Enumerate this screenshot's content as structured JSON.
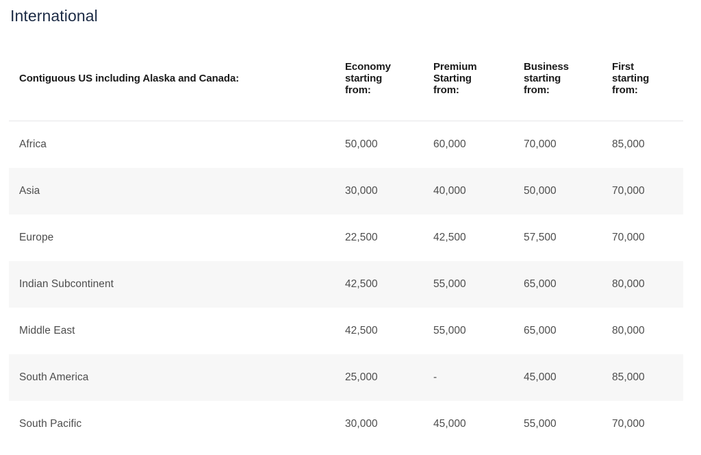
{
  "section": {
    "title": "International",
    "title_color": "#1c2b45"
  },
  "table": {
    "row_header_label": "Contiguous US including Alaska and Canada:",
    "columns": [
      {
        "key": "region",
        "lines": [
          "Contiguous US including Alaska and Canada:"
        ]
      },
      {
        "key": "economy",
        "lines": [
          "Economy",
          "starting",
          "from:"
        ]
      },
      {
        "key": "premium",
        "lines": [
          "Premium",
          "Starting",
          "from:"
        ]
      },
      {
        "key": "business",
        "lines": [
          "Business",
          "starting",
          "from:"
        ]
      },
      {
        "key": "first",
        "lines": [
          "First",
          "starting",
          "from:"
        ]
      }
    ],
    "rows": [
      {
        "region": "Africa",
        "economy": "50,000",
        "premium": "60,000",
        "business": "70,000",
        "first": "85,000",
        "stripe": false
      },
      {
        "region": "Asia",
        "economy": "30,000",
        "premium": "40,000",
        "business": "50,000",
        "first": "70,000",
        "stripe": true
      },
      {
        "region": "Europe",
        "economy": "22,500",
        "premium": "42,500",
        "business": "57,500",
        "first": "70,000",
        "stripe": false
      },
      {
        "region": "Indian Subcontinent",
        "economy": "42,500",
        "premium": "55,000",
        "business": "65,000",
        "first": "80,000",
        "stripe": true
      },
      {
        "region": "Middle East",
        "economy": "42,500",
        "premium": "55,000",
        "business": "65,000",
        "first": "80,000",
        "stripe": false
      },
      {
        "region": "South America",
        "economy": "25,000",
        "premium": "-",
        "business": "45,000",
        "first": "85,000",
        "stripe": true
      },
      {
        "region": "South Pacific",
        "economy": "30,000",
        "premium": "45,000",
        "business": "55,000",
        "first": "70,000",
        "stripe": false
      }
    ],
    "stripe_color": "#f7f7f7",
    "divider_color": "#e6e6e8",
    "text_color": "#4d4d4d",
    "header_text_color": "#1a1a1a"
  }
}
